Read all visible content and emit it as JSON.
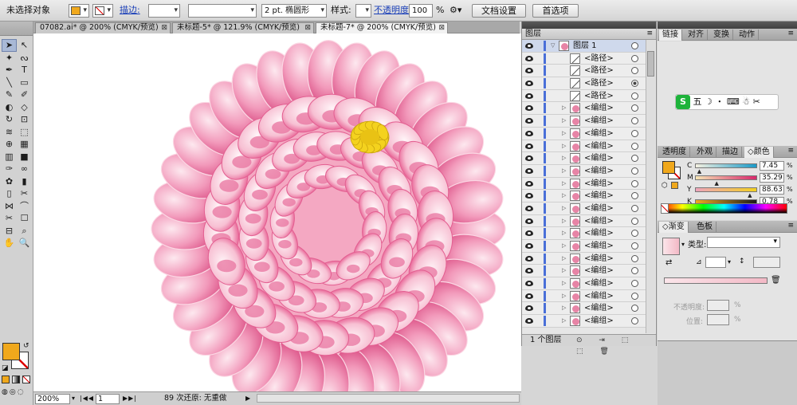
{
  "control_bar": {
    "selection_label": "未选择对象",
    "fill_color": "#f0a81c",
    "stroke_label": "描边:",
    "stroke_weight_value": "",
    "brush_value": "",
    "brush_stroke": "2 pt. 椭圆形",
    "style_label": "样式:",
    "opacity_label": "不透明度",
    "opacity_value": "100",
    "percent": "%",
    "doc_setup_button": "文档设置",
    "preferences_button": "首选项"
  },
  "tabs": [
    {
      "label": "07082.ai* @ 200% (CMYK/预览)",
      "close": "⊠"
    },
    {
      "label": "未标题-5* @ 121.9% (CMYK/预览)",
      "close": "⊠"
    },
    {
      "label": "未标题-7* @ 200% (CMYK/预览)",
      "close": "⊠"
    }
  ],
  "tools": {
    "items": [
      "selection-tool",
      "direct-selection-tool",
      "magic-wand-tool",
      "lasso-tool",
      "pen-tool",
      "type-tool",
      "line-tool",
      "rectangle-tool",
      "paintbrush-tool",
      "pencil-tool",
      "blob-brush-tool",
      "eraser-tool",
      "rotate-tool",
      "scale-tool",
      "warp-tool",
      "free-transform-tool",
      "shape-builder-tool",
      "perspective-tool",
      "mesh-tool",
      "gradient-tool",
      "eyedropper-tool",
      "blend-tool",
      "symbol-sprayer-tool",
      "column-graph-tool",
      "artboard-tool",
      "slice-tool",
      "width-tool",
      "reshape-tool",
      "knife-tool",
      "path-tool",
      "crop-tool",
      "zoom-area-tool",
      "hand-tool",
      "zoom-tool"
    ],
    "glyphs": [
      "➤",
      "↖",
      "✦",
      "ᔓ",
      "✒",
      "T",
      "╲",
      "▭",
      "✎",
      "✐",
      "◐",
      "◇",
      "↻",
      "⊡",
      "≋",
      "⬚",
      "⊕",
      "▦",
      "▥",
      "■",
      "✑",
      "∞",
      "✿",
      "▮",
      "▯",
      "✂",
      "⋈",
      "⌒",
      "✂",
      "☐",
      "⊟",
      "⌕",
      "✋",
      "🔍"
    ],
    "fill_color": "#f0a81c"
  },
  "status_bar": {
    "zoom": "200%",
    "page": "1",
    "history": "89 次还原: 无重做"
  },
  "layers_panel": {
    "title": "图层",
    "menu_icon": "≡",
    "rows": [
      {
        "name": "图层 1",
        "type": "layer",
        "target": "circle",
        "arrow": "▽"
      },
      {
        "name": "<路径>",
        "type": "path",
        "target": "circle"
      },
      {
        "name": "<路径>",
        "type": "path",
        "target": "circle"
      },
      {
        "name": "<路径>",
        "type": "path",
        "target": "filled"
      },
      {
        "name": "<路径>",
        "type": "path",
        "target": "circle"
      },
      {
        "name": "<编组>",
        "type": "group",
        "target": "circle",
        "arrow": "▷"
      },
      {
        "name": "<编组>",
        "type": "group",
        "target": "circle",
        "arrow": "▷"
      },
      {
        "name": "<编组>",
        "type": "group",
        "target": "circle",
        "arrow": "▷"
      },
      {
        "name": "<编组>",
        "type": "group",
        "target": "circle",
        "arrow": "▷"
      },
      {
        "name": "<编组>",
        "type": "group",
        "target": "circle",
        "arrow": "▷"
      },
      {
        "name": "<编组>",
        "type": "group",
        "target": "circle",
        "arrow": "▷"
      },
      {
        "name": "<编组>",
        "type": "group",
        "target": "circle",
        "arrow": "▷"
      },
      {
        "name": "<编组>",
        "type": "group",
        "target": "circle",
        "arrow": "▷"
      },
      {
        "name": "<编组>",
        "type": "group",
        "target": "circle",
        "arrow": "▷"
      },
      {
        "name": "<编组>",
        "type": "group",
        "target": "circle",
        "arrow": "▷"
      },
      {
        "name": "<编组>",
        "type": "group",
        "target": "circle",
        "arrow": "▷"
      },
      {
        "name": "<编组>",
        "type": "group",
        "target": "circle",
        "arrow": "▷"
      },
      {
        "name": "<编组>",
        "type": "group",
        "target": "circle",
        "arrow": "▷"
      },
      {
        "name": "<编组>",
        "type": "group",
        "target": "circle",
        "arrow": "▷"
      },
      {
        "name": "<编组>",
        "type": "group",
        "target": "circle",
        "arrow": "▷"
      },
      {
        "name": "<编组>",
        "type": "group",
        "target": "circle",
        "arrow": "▷"
      },
      {
        "name": "<编组>",
        "type": "group",
        "target": "circle",
        "arrow": "▷"
      },
      {
        "name": "<编组>",
        "type": "group",
        "target": "circle",
        "arrow": "▷"
      }
    ],
    "footer_label": "1 个图层",
    "footer_icons": "⊙ ⇥ ⬚ ⬚ 🗑"
  },
  "dock": {
    "top_tabs": [
      "链接",
      "对齐",
      "变换",
      "动作"
    ],
    "ime_bar": "五 ☽ ・ ⌨ ☃ ✂",
    "color_tabs": [
      "透明度",
      "外观",
      "描边",
      "◇颜色"
    ],
    "cmyk": [
      {
        "label": "C",
        "value": "7.45",
        "fraction": 0.0745,
        "gradient": "linear-gradient(90deg,#f4f0e0,#1a9ac8)"
      },
      {
        "label": "M",
        "value": "35.29",
        "fraction": 0.3529,
        "gradient": "linear-gradient(90deg,#f4e4b4,#d8286c)"
      },
      {
        "label": "Y",
        "value": "88.63",
        "fraction": 0.8863,
        "gradient": "linear-gradient(90deg,#eea4bc,#f2d020)"
      },
      {
        "label": "K",
        "value": "0.78",
        "fraction": 0.0078,
        "gradient": "linear-gradient(90deg,#f0aa1c,#1a1a1a)"
      }
    ],
    "gradient_tabs": [
      "◇渐变",
      "色板"
    ],
    "gradient_type_label": "类型:",
    "gradient_opacity_label": "不透明度:",
    "gradient_location_label": "位置:",
    "percent": "%",
    "fill_color": "#f0a81c"
  }
}
